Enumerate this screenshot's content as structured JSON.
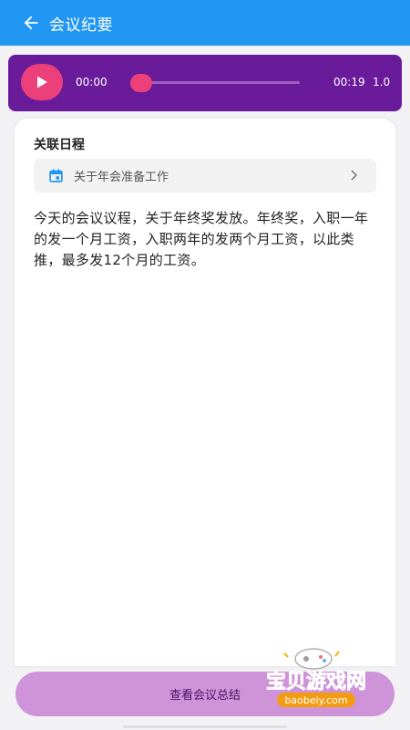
{
  "header": {
    "title": "会议纪要",
    "back_icon": "arrow-left-icon"
  },
  "player": {
    "current_time": "00:00",
    "total_time": "00:19",
    "speed": "1.0",
    "progress": 0.0,
    "play_icon": "play-icon"
  },
  "linked_schedule": {
    "title": "关联日程",
    "item_label": "关于年会准备工作",
    "icon": "calendar-icon"
  },
  "content": {
    "text": "今天的会议议程，关于年终奖发放。年终奖，入职一年的发一个月工资，入职两年的发两个月工资，以此类推，最多发12个月的工资。"
  },
  "footer": {
    "summary_button_label": "查看会议总结"
  },
  "watermark": {
    "brand": "宝贝游戏网",
    "url": "baobeiy.com"
  },
  "colors": {
    "app_bar": "#2196f3",
    "player_bg": "#6a1b9a",
    "accent": "#ec407a",
    "summary_button": "#ce93d8"
  }
}
